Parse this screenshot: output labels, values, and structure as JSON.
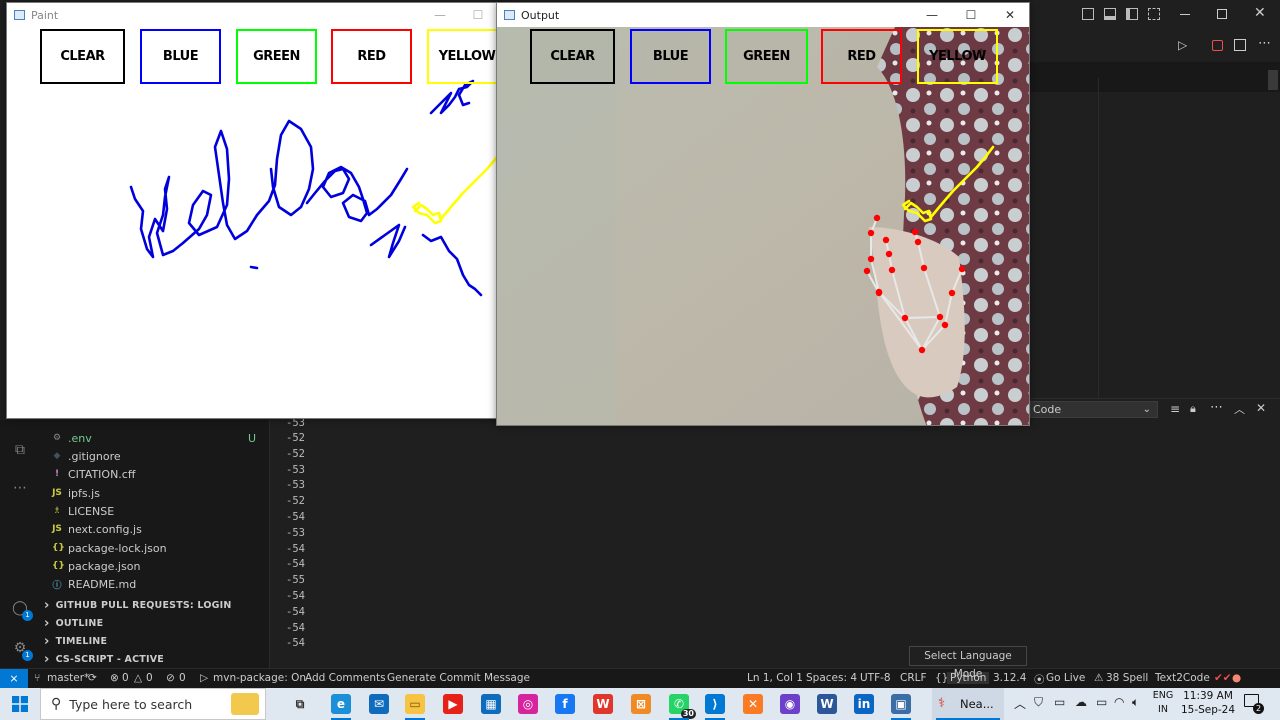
{
  "paint_window": {
    "title": "Paint",
    "buttons": [
      {
        "label": "CLEAR",
        "color": "#000000"
      },
      {
        "label": "BLUE",
        "color": "#0000ff"
      },
      {
        "label": "GREEN",
        "color": "#00ff00"
      },
      {
        "label": "RED",
        "color": "#ff0000"
      },
      {
        "label": "YELLOW",
        "color": "#ffff00"
      }
    ],
    "stroke_colors": {
      "blue": "#0000dd",
      "yellow": "#ffff00"
    }
  },
  "output_window": {
    "title": "Output",
    "buttons": [
      {
        "label": "CLEAR",
        "color": "#000000"
      },
      {
        "label": "BLUE",
        "color": "#0000ff"
      },
      {
        "label": "GREEN",
        "color": "#00ff00"
      },
      {
        "label": "RED",
        "color": "#ff0000"
      },
      {
        "label": "YELLOW",
        "color": "#ffff00"
      }
    ],
    "landmark_color": "#ff0000"
  },
  "vscode": {
    "explorer_files": [
      {
        "name": ".env",
        "icon": "gear-icon",
        "icon_glyph": "⚙",
        "icon_color": "#8a8a8a",
        "badge": "U",
        "name_color": "#73c991"
      },
      {
        "name": ".gitignore",
        "icon": "git-icon",
        "icon_glyph": "◆",
        "icon_color": "#41535b",
        "badge": "",
        "name_color": "#cccccc"
      },
      {
        "name": "CITATION.cff",
        "icon": "exclamation-icon",
        "icon_glyph": "!",
        "icon_color": "#c586c0",
        "badge": "",
        "name_color": "#cccccc"
      },
      {
        "name": "ipfs.js",
        "icon": "js-icon",
        "icon_glyph": "JS",
        "icon_color": "#cbcb41",
        "badge": "",
        "name_color": "#cccccc"
      },
      {
        "name": "LICENSE",
        "icon": "license-icon",
        "icon_glyph": "♗",
        "icon_color": "#cbcb41",
        "badge": "",
        "name_color": "#cccccc"
      },
      {
        "name": "next.config.js",
        "icon": "js-icon",
        "icon_glyph": "JS",
        "icon_color": "#cbcb41",
        "badge": "",
        "name_color": "#cccccc"
      },
      {
        "name": "package-lock.json",
        "icon": "json-icon",
        "icon_glyph": "{}",
        "icon_color": "#cbcb41",
        "badge": "",
        "name_color": "#cccccc"
      },
      {
        "name": "package.json",
        "icon": "json-icon",
        "icon_glyph": "{}",
        "icon_color": "#cbcb41",
        "badge": "",
        "name_color": "#cccccc"
      },
      {
        "name": "README.md",
        "icon": "info-icon",
        "icon_glyph": "ⓘ",
        "icon_color": "#519aba",
        "badge": "",
        "name_color": "#cccccc"
      }
    ],
    "sections": [
      {
        "label": "GITHUB PULL REQUESTS: LOGIN"
      },
      {
        "label": "OUTLINE"
      },
      {
        "label": "TIMELINE"
      },
      {
        "label": "CS-SCRIPT - ACTIVE"
      }
    ],
    "output_lines": [
      "-52",
      "-52",
      "-53",
      "-53",
      "-52",
      "-54",
      "-53",
      "-54",
      "-54",
      "-55",
      "-54",
      "-54",
      "-54",
      "-54"
    ],
    "output_top_partial": "-53",
    "panel_dropdown": "Code",
    "tooltip": "Select Language Mode",
    "status": {
      "branch": "master*",
      "errors": "0",
      "warnings": "0",
      "ports": "0",
      "mvn": "mvn-package: On",
      "add_comments": "Add Comments",
      "generate_commit": "Generate Commit Message",
      "position": "Ln 1, Col 1",
      "spaces": "Spaces: 4",
      "encoding": "UTF-8",
      "eol": "CRLF",
      "language": "Python",
      "version": "3.12.4",
      "go_live": "Go Live",
      "spell": "38 Spell",
      "text2code": "Text2Code"
    }
  },
  "taskbar": {
    "search_placeholder": "Type here to search",
    "apps": [
      {
        "name": "task-view",
        "glyph": "⧉",
        "color": "#333333",
        "bg": "transparent"
      },
      {
        "name": "edge",
        "glyph": "e",
        "color": "#ffffff",
        "bg": "#1b8fd8"
      },
      {
        "name": "mail",
        "glyph": "✉",
        "color": "#ffffff",
        "bg": "#0f6cbd"
      },
      {
        "name": "file-explorer",
        "glyph": "▭",
        "color": "#7a5200",
        "bg": "#f6c343"
      },
      {
        "name": "youtube",
        "glyph": "▶",
        "color": "#ffffff",
        "bg": "#e62117"
      },
      {
        "name": "store",
        "glyph": "▦",
        "color": "#ffffff",
        "bg": "#0f6cbd"
      },
      {
        "name": "instagram",
        "glyph": "◎",
        "color": "#ffffff",
        "bg": "#d6249f"
      },
      {
        "name": "facebook",
        "glyph": "f",
        "color": "#ffffff",
        "bg": "#1877f2"
      },
      {
        "name": "wps",
        "glyph": "W",
        "color": "#ffffff",
        "bg": "#e0362c"
      },
      {
        "name": "app-orange",
        "glyph": "⊠",
        "color": "#ffffff",
        "bg": "#f08a24"
      },
      {
        "name": "whatsapp",
        "glyph": "✆",
        "color": "#ffffff",
        "bg": "#25d366",
        "count": "30"
      },
      {
        "name": "vscode",
        "glyph": "⟩",
        "color": "#ffffff",
        "bg": "#0078d4"
      },
      {
        "name": "xampp",
        "glyph": "✕",
        "color": "#ffffff",
        "bg": "#fb7a24"
      },
      {
        "name": "github",
        "glyph": "◉",
        "color": "#ffffff",
        "bg": "#6e40c9"
      },
      {
        "name": "word",
        "glyph": "W",
        "color": "#ffffff",
        "bg": "#2b579a"
      },
      {
        "name": "linkedin",
        "glyph": "in",
        "color": "#ffffff",
        "bg": "#0a66c2"
      },
      {
        "name": "python-window",
        "glyph": "▣",
        "color": "#ffffff",
        "bg": "#3b6ea5"
      }
    ],
    "running_app_label": "Nea...",
    "lang_line1": "ENG",
    "lang_line2": "IN",
    "time": "11:39 AM",
    "date": "15-Sep-24",
    "notification_count": "2"
  }
}
